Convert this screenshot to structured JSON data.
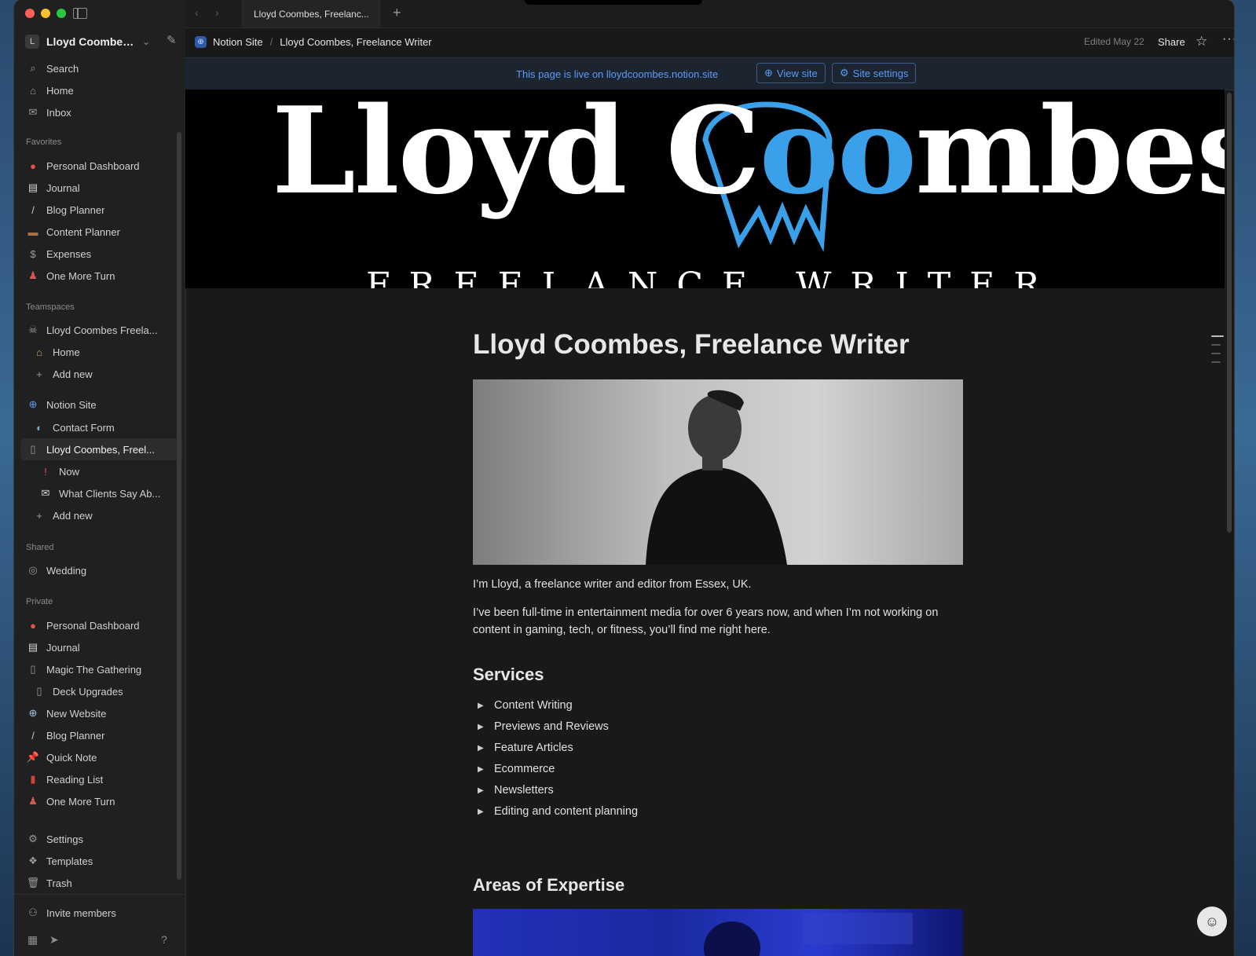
{
  "window": {
    "tab_title": "Lloyd Coombes, Freelanc...",
    "colors": {
      "close": "#ff5f57",
      "minimize": "#febc2e",
      "zoom": "#28c840",
      "accent": "#5b9cf5",
      "logo_blue": "#3aa0ea"
    }
  },
  "workspace": {
    "avatar_letter": "L",
    "name": "Lloyd Coombes's..."
  },
  "sidebar": {
    "top_items": [
      {
        "label": "Search",
        "icon": "search-icon"
      },
      {
        "label": "Home",
        "icon": "home-icon"
      },
      {
        "label": "Inbox",
        "icon": "inbox-icon"
      }
    ],
    "favorites_header": "Favorites",
    "favorites": [
      {
        "label": "Personal Dashboard",
        "icon": "siren-icon"
      },
      {
        "label": "Journal",
        "icon": "calendar-icon"
      },
      {
        "label": "Blog Planner",
        "icon": "pen-icon"
      },
      {
        "label": "Content Planner",
        "icon": "briefcase-icon"
      },
      {
        "label": "Expenses",
        "icon": "dollar-icon"
      },
      {
        "label": "One More Turn",
        "icon": "joystick-icon"
      }
    ],
    "teamspaces_header": "Teamspaces",
    "teamspaces": [
      {
        "label": "Lloyd Coombes Freela...",
        "icon": "pirate-icon"
      },
      {
        "label": "Home",
        "icon": "house-icon"
      },
      {
        "label": "Add new",
        "icon": "plus-icon"
      },
      {
        "label": "Notion Site",
        "icon": "globe-icon"
      },
      {
        "label": "Contact Form",
        "icon": "speech-icon"
      },
      {
        "label": "Lloyd Coombes, Freel...",
        "icon": "page-icon"
      },
      {
        "label": "Now",
        "icon": "exclamation-icon"
      },
      {
        "label": "What Clients Say Ab...",
        "icon": "envelope-icon"
      },
      {
        "label": "Add new",
        "icon": "plus-icon"
      }
    ],
    "shared_header": "Shared",
    "shared": [
      {
        "label": "Wedding",
        "icon": "ring-icon"
      }
    ],
    "private_header": "Private",
    "private": [
      {
        "label": "Personal Dashboard",
        "icon": "siren-icon"
      },
      {
        "label": "Journal",
        "icon": "calendar-icon"
      },
      {
        "label": "Magic The Gathering",
        "icon": "page-icon"
      },
      {
        "label": "Deck Upgrades",
        "icon": "page-icon"
      },
      {
        "label": "New Website",
        "icon": "globe-icon"
      },
      {
        "label": "Blog Planner",
        "icon": "pen-icon"
      },
      {
        "label": "Quick Note",
        "icon": "pin-icon"
      },
      {
        "label": "Reading List",
        "icon": "book-icon"
      },
      {
        "label": "One More Turn",
        "icon": "joystick-icon"
      }
    ],
    "bottom": [
      {
        "label": "Settings",
        "icon": "gear-icon"
      },
      {
        "label": "Templates",
        "icon": "templates-icon"
      },
      {
        "label": "Trash",
        "icon": "trash-icon"
      }
    ],
    "invite": "Invite members"
  },
  "topbar": {
    "crumb_site": "Notion Site",
    "crumb_sep": "/",
    "crumb_page": "Lloyd Coombes, Freelance Writer",
    "edited": "Edited May 22",
    "share": "Share"
  },
  "banner": {
    "text": "This page is live on lloydcoombes.notion.site",
    "view_site": "View site",
    "site_settings": "Site settings"
  },
  "cover": {
    "name_part1": "Lloyd C",
    "name_oo": "oo",
    "name_part2": "mbes",
    "subtitle": "FREELANCE WRITER"
  },
  "page": {
    "title": "Lloyd Coombes, Freelance Writer",
    "intro": "I’m Lloyd, a freelance writer and editor from Essex, UK.",
    "bio": "I’ve been full-time in entertainment media for over 6 years now, and when I’m not working on content in gaming, tech, or fitness, you’ll find me right here.",
    "services_heading": "Services",
    "services": [
      "Content Writing",
      "Previews and Reviews",
      "Feature Articles",
      "Ecommerce",
      "Newsletters",
      "Editing and content planning"
    ],
    "expertise_heading": "Areas of Expertise"
  }
}
